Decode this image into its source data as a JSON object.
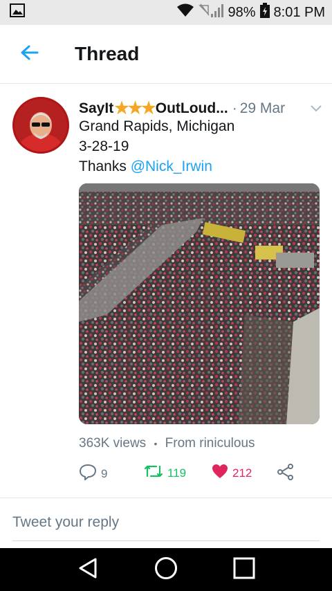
{
  "status_bar": {
    "battery": "98%",
    "time": "8:01 PM"
  },
  "header": {
    "title": "Thread"
  },
  "tweet": {
    "author": {
      "name_prefix": "SayIt",
      "stars": "★★★",
      "name_suffix": "OutLoud...",
      "name_suffix_note": ""
    },
    "dot": "·",
    "date": "29 Mar",
    "lines": [
      "Grand Rapids, Michigan",
      "3-28-19"
    ],
    "thanks_prefix": "Thanks ",
    "mention": "@Nick_Irwin",
    "views": "363K views",
    "separator": "•",
    "source": "From riniculous",
    "replies": "9",
    "retweets": "119",
    "likes": "212"
  },
  "reply_box": {
    "placeholder": "Tweet your reply"
  },
  "colors": {
    "accent": "#1da1f2",
    "retweet": "#17bf63",
    "like": "#e0245e",
    "muted": "#657786"
  },
  "icons": [
    "gallery-icon",
    "wifi-icon",
    "signal-icon",
    "battery-icon",
    "back-arrow-icon",
    "chevron-down-icon",
    "reply-icon",
    "retweet-icon",
    "heart-icon",
    "share-icon",
    "nav-back-icon",
    "nav-home-icon",
    "nav-recents-icon"
  ]
}
